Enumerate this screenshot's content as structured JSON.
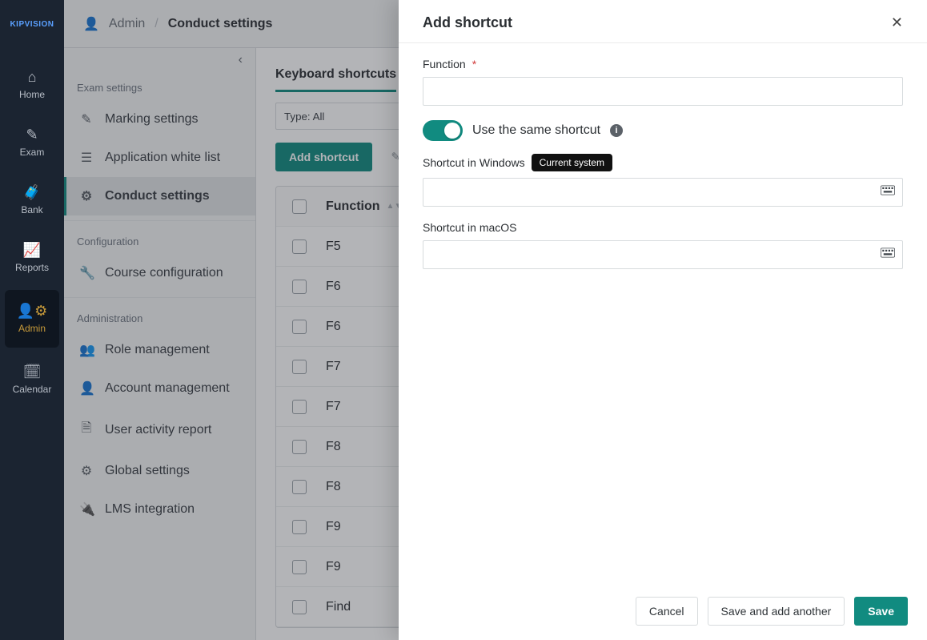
{
  "brand": "KIPVISION",
  "nav": [
    {
      "key": "home",
      "label": "Home",
      "icon": "home-icon"
    },
    {
      "key": "exam",
      "label": "Exam",
      "icon": "pencil-icon"
    },
    {
      "key": "bank",
      "label": "Bank",
      "icon": "briefcase-icon"
    },
    {
      "key": "reports",
      "label": "Reports",
      "icon": "chart-icon"
    },
    {
      "key": "admin",
      "label": "Admin",
      "icon": "user-gear-icon",
      "active": true
    },
    {
      "key": "calendar",
      "label": "Calendar",
      "icon": "calendar-icon"
    }
  ],
  "breadcrumb": {
    "root": "Admin",
    "current": "Conduct settings"
  },
  "sidebar": {
    "groups": [
      {
        "title": "Exam settings",
        "items": [
          {
            "label": "Marking settings",
            "icon": "pen-icon"
          },
          {
            "label": "Application white list",
            "icon": "list-icon"
          },
          {
            "label": "Conduct settings",
            "icon": "gears-icon",
            "active": true
          }
        ]
      },
      {
        "title": "Configuration",
        "items": [
          {
            "label": "Course configuration",
            "icon": "wrench-icon"
          }
        ]
      },
      {
        "title": "Administration",
        "items": [
          {
            "label": "Role management",
            "icon": "users-icon"
          },
          {
            "label": "Account management",
            "icon": "user-icon"
          },
          {
            "label": "User activity report",
            "icon": "clipboard-icon"
          },
          {
            "label": "Global settings",
            "icon": "gear-icon"
          },
          {
            "label": "LMS integration",
            "icon": "plug-icon"
          }
        ]
      }
    ]
  },
  "page": {
    "tabs": [
      {
        "label": "Keyboard shortcuts",
        "active": true
      }
    ],
    "filter_value": "Type: All",
    "toolbar": {
      "add_label": "Add shortcut"
    },
    "table": {
      "header": {
        "function": "Function"
      },
      "rows": [
        {
          "function": "F5"
        },
        {
          "function": "F6"
        },
        {
          "function": "F6"
        },
        {
          "function": "F7"
        },
        {
          "function": "F7"
        },
        {
          "function": "F8"
        },
        {
          "function": "F8"
        },
        {
          "function": "F9"
        },
        {
          "function": "F9"
        },
        {
          "function": "Find"
        }
      ]
    }
  },
  "drawer": {
    "title": "Add shortcut",
    "function_label": "Function",
    "same_shortcut_label": "Use the same shortcut",
    "same_shortcut_on": true,
    "windows_label": "Shortcut in Windows",
    "current_system_badge": "Current system",
    "macos_label": "Shortcut in macOS",
    "buttons": {
      "cancel": "Cancel",
      "save_another": "Save and add another",
      "save": "Save"
    }
  }
}
